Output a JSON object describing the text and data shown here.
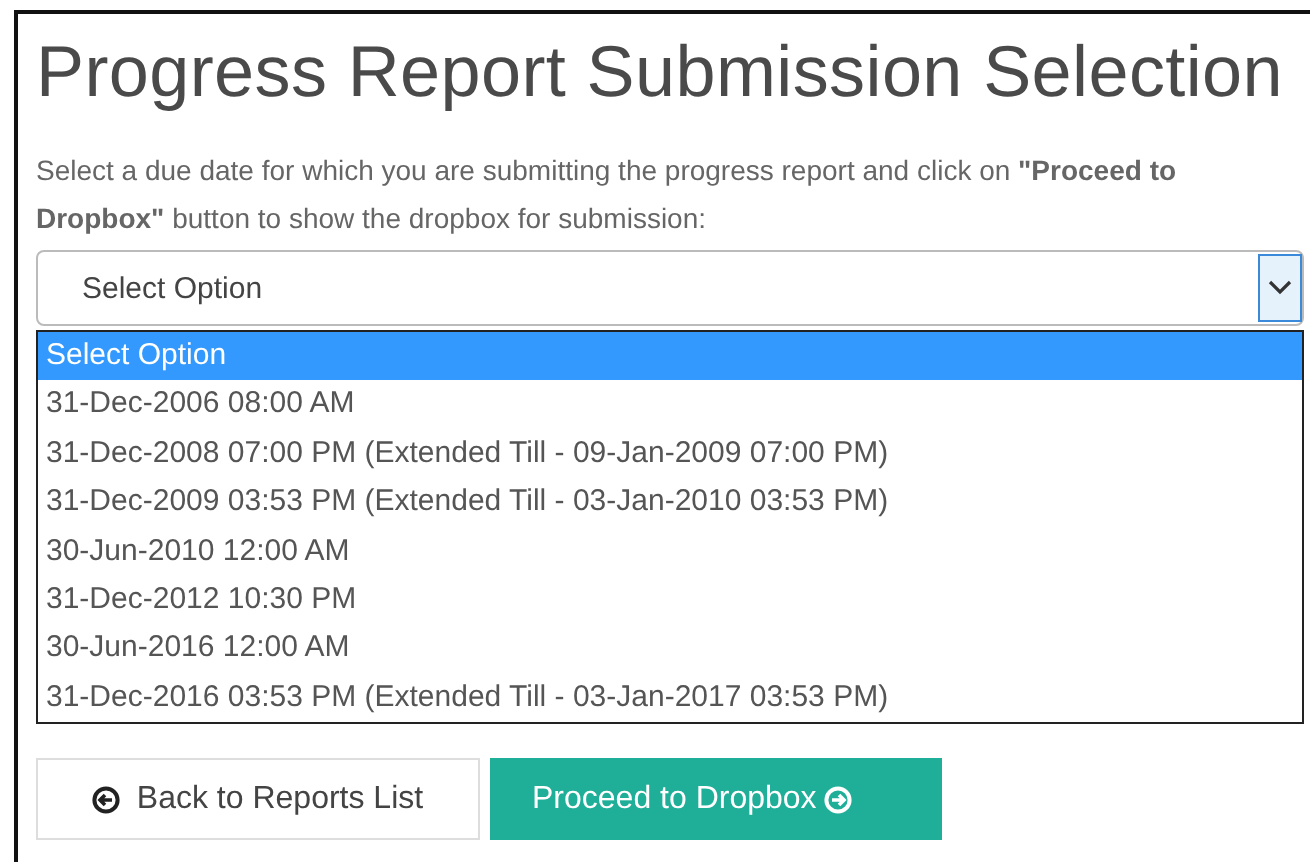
{
  "title": "Progress Report Submission Selection",
  "instructions": "Select a due date for which you are submitting the progress report and click on **\"Proceed to Dropbox\"** button to show the dropbox for submission:",
  "select": {
    "value": "Select Option",
    "expanded": true
  },
  "options": [
    {
      "label": "Select Option",
      "selected": true
    },
    {
      "label": "31-Dec-2006 08:00 AM",
      "selected": false
    },
    {
      "label": "31-Dec-2008 07:00 PM (Extended Till - 09-Jan-2009 07:00 PM)",
      "selected": false
    },
    {
      "label": "31-Dec-2009 03:53 PM (Extended Till - 03-Jan-2010 03:53 PM)",
      "selected": false
    },
    {
      "label": "30-Jun-2010 12:00 AM",
      "selected": false
    },
    {
      "label": "31-Dec-2012 10:30 PM",
      "selected": false
    },
    {
      "label": "30-Jun-2016 12:00 AM",
      "selected": false
    },
    {
      "label": "31-Dec-2016 03:53 PM (Extended Till - 03-Jan-2017 03:53 PM)",
      "selected": false
    }
  ],
  "buttons": [
    {
      "kind": "back",
      "label": "Back to Reports List"
    },
    {
      "kind": "proceed",
      "label": "Proceed to Dropbox"
    }
  ]
}
